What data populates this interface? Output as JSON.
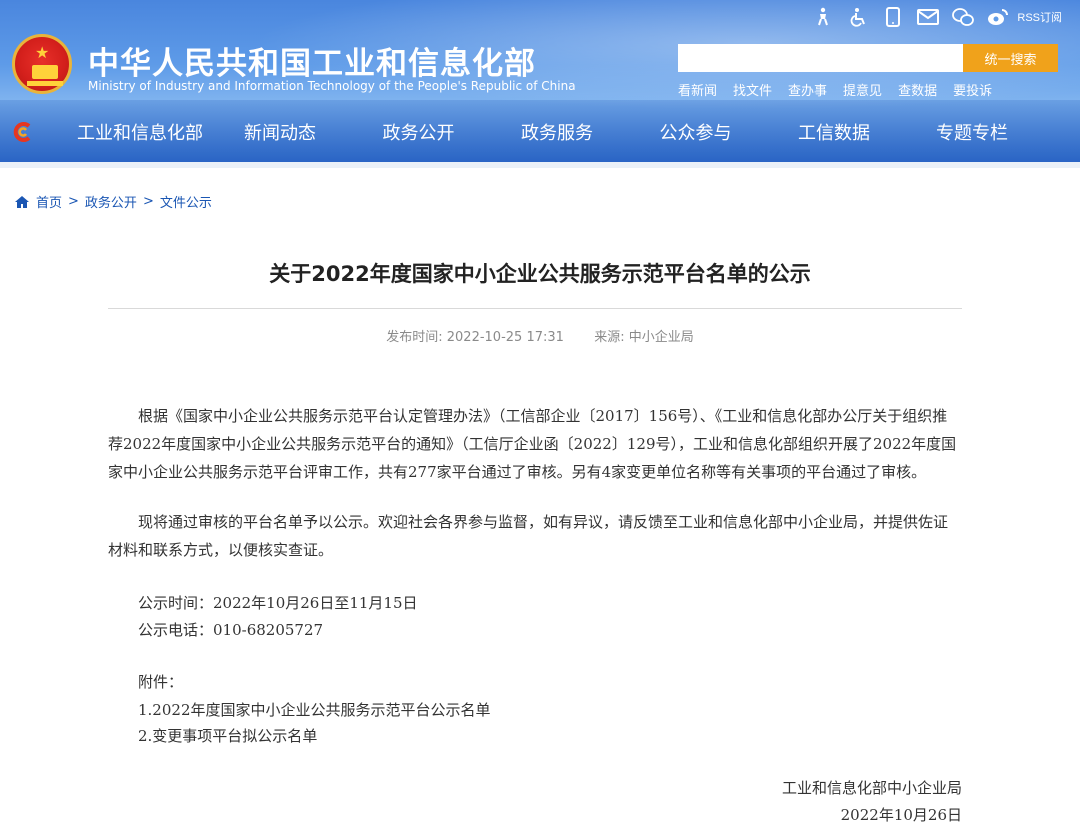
{
  "header": {
    "title_cn": "中华人民共和国工业和信息化部",
    "title_en": "Ministry of Industry and Information Technology of the People's Republic of China",
    "rss_label": "RSS订阅",
    "search": {
      "value": "",
      "placeholder": "",
      "button_label": "统一搜索"
    },
    "quick_links": [
      "看新闻",
      "找文件",
      "查办事",
      "提意见",
      "查数据",
      "要投诉"
    ],
    "nav": [
      "工业和信息化部",
      "新闻动态",
      "政务公开",
      "政务服务",
      "公众参与",
      "工信数据",
      "专题专栏"
    ],
    "colors": {
      "banner_blue": "#4a86de",
      "search_orange": "#f0a21b"
    }
  },
  "breadcrumb": {
    "items": [
      "首页",
      "政务公开",
      "文件公示"
    ],
    "separator": ">"
  },
  "article": {
    "title": "关于2022年度国家中小企业公共服务示范平台名单的公示",
    "meta": {
      "publish_label": "发布时间:",
      "publish_time": "2022-10-25 17:31",
      "source_label": "来源:",
      "source": "中小企业局"
    },
    "paragraph1": "根据《国家中小企业公共服务示范平台认定管理办法》（工信部企业〔2017〕156号）、《工业和信息化部办公厅关于组织推荐2022年度国家中小企业公共服务示范平台的通知》（工信厅企业函〔2022〕129号），工业和信息化部组织开展了2022年度国家中小企业公共服务示范平台评审工作，共有277家平台通过了审核。另有4家变更单位名称等有关事项的平台通过了审核。",
    "paragraph2": "现将通过审核的平台名单予以公示。欢迎社会各界参与监督，如有异议，请反馈至工业和信息化部中小企业局，并提供佐证材料和联系方式，以便核实查证。",
    "notice_time": "公示时间：2022年10月26日至11月15日",
    "notice_phone": "公示电话：010-68205727",
    "attachments_label": "附件：",
    "attachments": [
      "1.2022年度国家中小企业公共服务示范平台公示名单",
      "2.变更事项平台拟公示名单"
    ],
    "signature_org": "工业和信息化部中小企业局",
    "signature_date": "2022年10月26日"
  },
  "icons": [
    "elder-mode-icon",
    "accessibility-icon",
    "mobile-icon",
    "mail-icon",
    "wechat-icon",
    "weibo-icon",
    "rss-icon",
    "home-icon",
    "national-emblem-icon",
    "site-logo-icon"
  ]
}
